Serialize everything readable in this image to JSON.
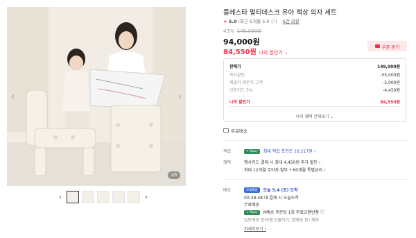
{
  "product": {
    "title": "플레스타 멀티데스크 유아 책상 의자 세트",
    "rating_star": "★",
    "rating_score": "5.0",
    "rating_recent": "(최근 6개월 5.0 ⓘ)",
    "review_link": "6건 리뷰",
    "discount_pct": "43%",
    "original_price": "149,000원",
    "sale_price": "94,000원",
    "my_price": "84,550원",
    "my_price_label": "나의 할인가 ⌄",
    "coupon_label": "쿠폰 받기"
  },
  "image": {
    "counter": "1/5",
    "prev_icon": "‹",
    "next_icon": "›",
    "thumb_prev": "‹",
    "thumb_next": "›"
  },
  "price_box": {
    "rows": [
      {
        "label": "판매가",
        "value": "149,000원"
      },
      {
        "label": "즉시할인",
        "value": "-55,000원"
      },
      {
        "label": "패밀리 레몬치 고객",
        "value": "-5,000원"
      },
      {
        "label": "신한카드 5%",
        "value": "-4,450원"
      }
    ],
    "my_label": "나의 할인가",
    "my_value": "84,550원",
    "more": "나의 혜택 전체보기 ⌄"
  },
  "shipping_top": "무료배송",
  "points": {
    "label": "적립",
    "badge": "+ Npay",
    "text": "최대 적립 포인트 10,217원 ›"
  },
  "benefit": {
    "label": "혜택",
    "line1": "행사카드 결제 시 최대 4,450원 추가 할인 ›",
    "line2": "최대 12개월 무이자 할부 • 60개월 특별금리 ›"
  },
  "delivery": {
    "label": "배송",
    "badge": "오늘배송",
    "today": "오늘 5.4 (토) 도착",
    "deadline": "00:38:48  내 결제 시 오늘도착",
    "free": "무료배송",
    "npay_badge": "+ Npay",
    "npay_text": "N배송 주문당 1회 무료교환반품 ⓘ",
    "note": "일반배송 인터넷(선물하기, 합배송 등) 제외",
    "more": "자세히보기 ›"
  },
  "colors": {
    "accent_red": "#f0304a",
    "npay_green": "#2e8b57",
    "delivery_blue": "#2e54c8"
  }
}
